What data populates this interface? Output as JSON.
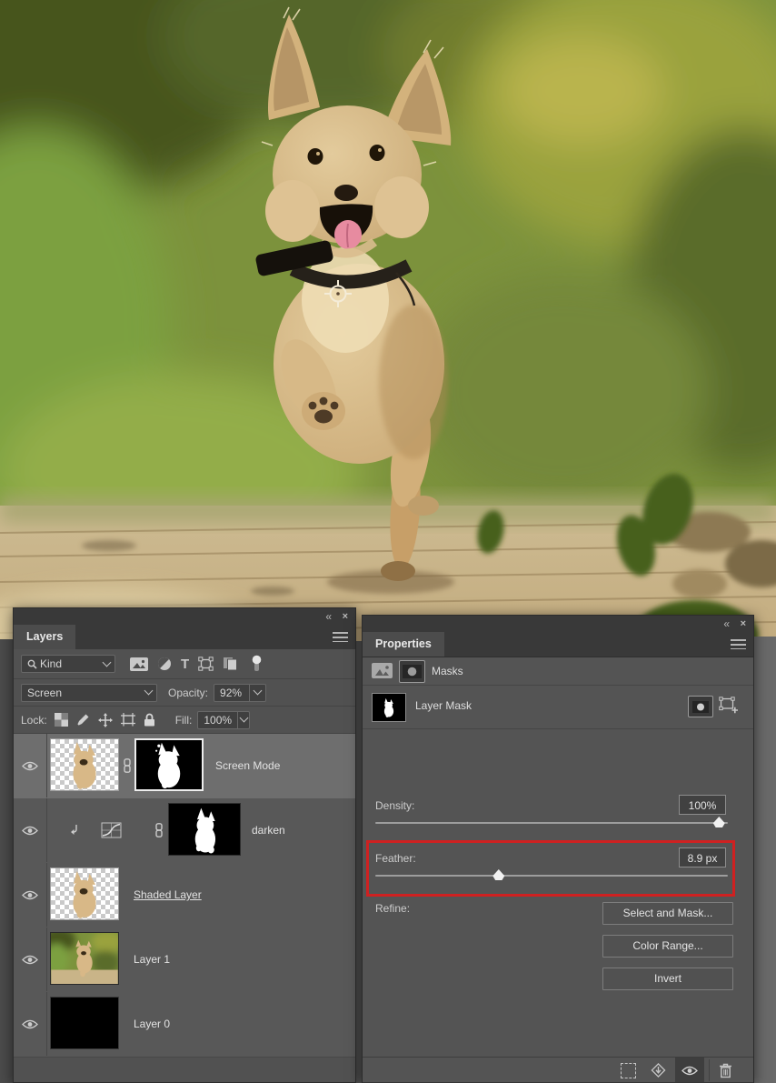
{
  "colors": {
    "accent_red": "#cf2121",
    "panel_bg": "#515151",
    "selected_row": "#6e6e6e"
  },
  "canvas": {
    "cursor": "target-sample-cursor"
  },
  "layers_panel": {
    "tab": "Layers",
    "window_controls": {
      "collapse": "«",
      "close": "×"
    },
    "filter": {
      "kind_label": "Kind",
      "type_filter_glyph": "T"
    },
    "blend_mode": "Screen",
    "opacity": {
      "label": "Opacity:",
      "value": "92%"
    },
    "lock": {
      "label": "Lock:"
    },
    "fill": {
      "label": "Fill:",
      "value": "100%"
    },
    "layers": [
      {
        "name": "Screen Mode",
        "selected": true,
        "has_mask": true,
        "linked": true
      },
      {
        "name": "darken",
        "adjustment": "curves",
        "clipped": true,
        "has_mask": true,
        "linked": true
      },
      {
        "name": "Shaded Layer",
        "renaming_underline": true
      },
      {
        "name": "Layer 1"
      },
      {
        "name": "Layer 0"
      }
    ]
  },
  "properties_panel": {
    "tab": "Properties",
    "window_controls": {
      "collapse": "«",
      "close": "×"
    },
    "masks_label": "Masks",
    "layer_mask_label": "Layer Mask",
    "density": {
      "label": "Density:",
      "value": "100%",
      "slider_pct": 97.5
    },
    "feather": {
      "label": "Feather:",
      "value": "8.9 px",
      "slider_pct": 35
    },
    "refine": {
      "label": "Refine:",
      "buttons": [
        "Select and Mask...",
        "Color Range...",
        "Invert"
      ]
    }
  }
}
